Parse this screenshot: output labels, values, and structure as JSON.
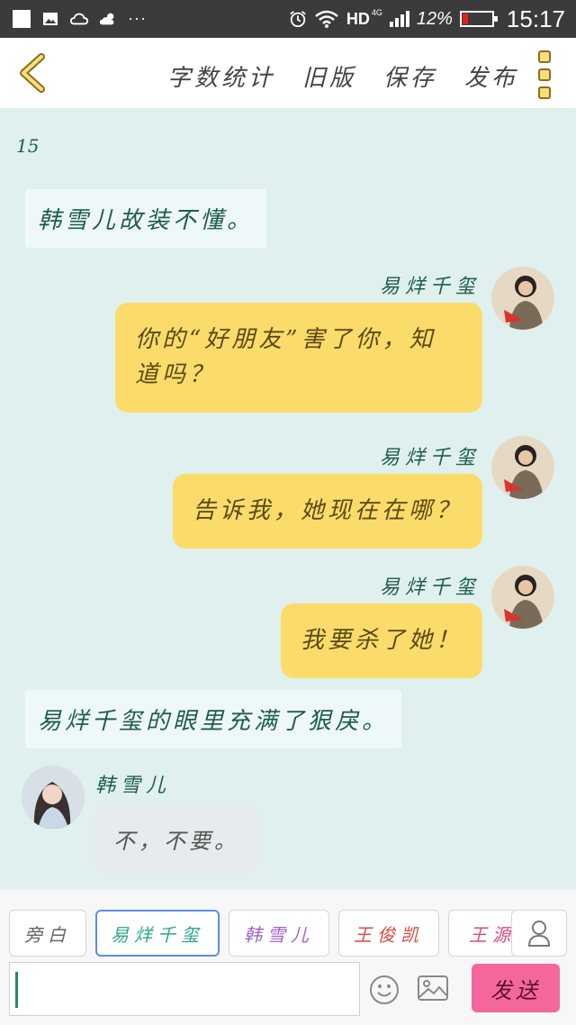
{
  "status_bar": {
    "network": "HD",
    "network_sub": "4G",
    "battery_percent": "12%",
    "time": "15:17",
    "icons": [
      "notification-square-icon",
      "image-icon",
      "cloud-icon",
      "weather-icon",
      "more-dots-icon",
      "alarm-icon",
      "wifi-icon",
      "signal-icon",
      "battery-icon"
    ],
    "more": "···"
  },
  "toolbar": {
    "word_count": "字数统计",
    "old_version": "旧版",
    "save": "保存",
    "publish": "发布"
  },
  "chat": {
    "count": "15",
    "messages": [
      {
        "type": "narration",
        "text": "韩雪儿故装不懂。"
      },
      {
        "type": "right",
        "name": "易烊千玺",
        "text": "你的“好朋友”害了你，知道吗？"
      },
      {
        "type": "right",
        "name": "易烊千玺",
        "text": "告诉我，她现在在哪？"
      },
      {
        "type": "right",
        "name": "易烊千玺",
        "text": "我要杀了她！"
      },
      {
        "type": "narration",
        "text": "易烊千玺的眼里充满了狠戾。"
      },
      {
        "type": "left",
        "name": "韩雪儿",
        "text": "不，不要。"
      }
    ]
  },
  "roles": [
    {
      "label": "旁白",
      "color": "#666666"
    },
    {
      "label": "易烊千玺",
      "color": "#2aa889",
      "selected": true
    },
    {
      "label": "韩雪儿",
      "color": "#a163c9"
    },
    {
      "label": "王俊凯",
      "color": "#e0483d"
    },
    {
      "label": "王源",
      "color": "#e0487e"
    }
  ],
  "composer": {
    "send_label": "发送",
    "input_value": ""
  },
  "colors": {
    "chat_bg": "#dff0ef",
    "right_bubble": "#fbdc6b",
    "send_button": "#f4679d"
  }
}
